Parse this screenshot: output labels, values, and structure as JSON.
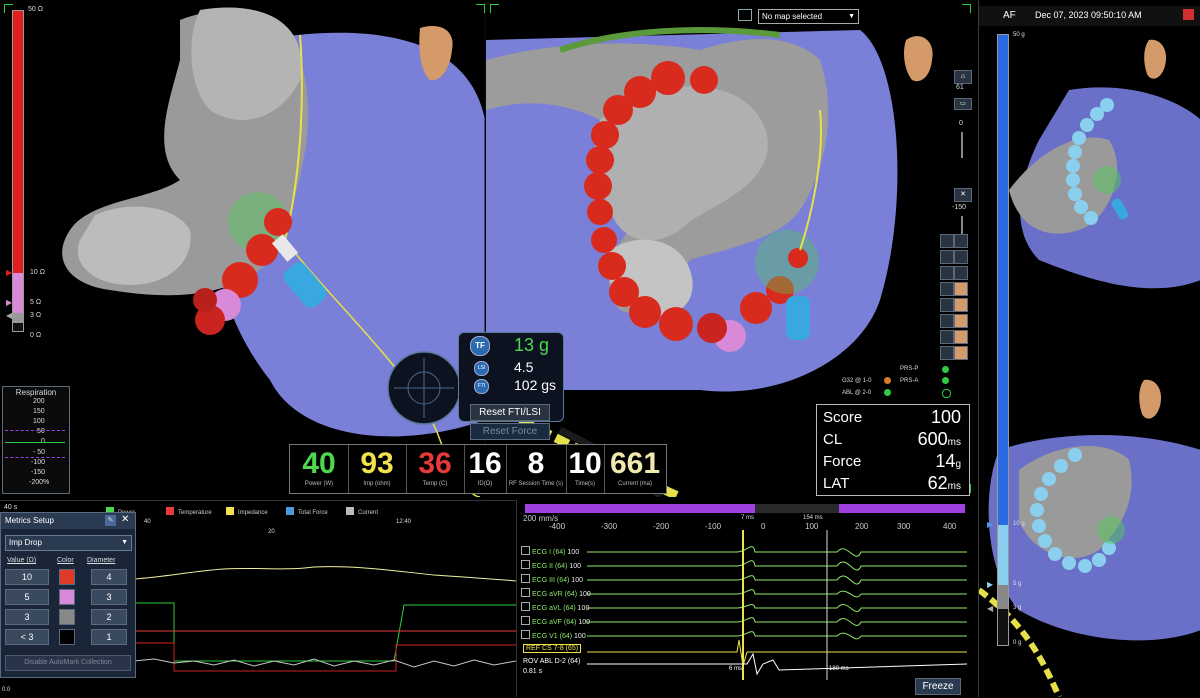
{
  "top_bar": {
    "map_select_value": "No map selected",
    "rhythm": "AF",
    "datetime": "Dec 07, 2023 09:50:10 AM"
  },
  "impedance_scale": {
    "top": "50 Ω",
    "mark_10": "10 Ω",
    "mark_5": "5 Ω",
    "mark_3": "3 Ω",
    "bottom": "0 Ω"
  },
  "force_scale": {
    "top": "50 g",
    "mark_10": "10 g",
    "mark_5": "5 g",
    "mark_3": "3 g",
    "bottom": "0 g"
  },
  "respiration": {
    "title": "Respiration",
    "ticks": [
      "200",
      "150",
      "100",
      "50",
      "0",
      "- 50",
      "-100",
      "-150",
      "-200%"
    ]
  },
  "contact_widget": {
    "tf_label": "TF",
    "tf_value": "13 g",
    "lsi_label": "LSI",
    "lsi_value": "4.5",
    "fti_label": "FTI",
    "fti_value": "102 gs",
    "reset_fti_label": "Reset FTI/LSI",
    "reset_force_label": "Reset Force"
  },
  "metrics": [
    {
      "value": "40",
      "label": "Power (W)",
      "color": "#4cd84c"
    },
    {
      "value": "93",
      "label": "Imp (ohm)",
      "color": "#f0e24a"
    },
    {
      "value": "36",
      "label": "Temp (C)",
      "color": "#e83a3a"
    },
    {
      "value": "16",
      "label": "ID(Ω)",
      "color": "#ffffff"
    },
    {
      "value": "8",
      "label": "RF Session Time (s)",
      "color": "#ffffff"
    },
    {
      "value": "10",
      "label": "Time(s)",
      "color": "#ffffff"
    },
    {
      "value": "661",
      "label": "Current (ma)",
      "color": "#f2e9b0"
    }
  ],
  "score_panel": {
    "rows": [
      {
        "label": "Score",
        "value": "100",
        "unit": ""
      },
      {
        "label": "CL",
        "value": "600",
        "unit": "ms"
      },
      {
        "label": "Force",
        "value": "14",
        "unit": "g"
      },
      {
        "label": "LAT",
        "value": "62",
        "unit": "ms"
      }
    ]
  },
  "catheter_status": {
    "prs_p": "PRS-P",
    "g32": "G32 @ 1-0",
    "prs_a": "PRS-A",
    "abl": "ABL @ 2-0"
  },
  "toolbar_right": {
    "count": "61",
    "value_0": "0",
    "value_neg150": "-150"
  },
  "trend_panel": {
    "duration": "40 s",
    "legend": [
      {
        "label": "Power",
        "color": "#4cd84c"
      },
      {
        "label": "Temperature",
        "color": "#e83a3a"
      },
      {
        "label": "Impedance",
        "color": "#f0e24a"
      },
      {
        "label": "Total Force",
        "color": "#4a9ae0"
      },
      {
        "label": "Current",
        "color": "#bbbbbb"
      }
    ],
    "time_marks": [
      "40",
      "20",
      "12:40"
    ],
    "bottom_value": "0.0"
  },
  "metrics_setup": {
    "title": "Metrics Setup",
    "dropdown_value": "Imp Drop",
    "headers": [
      "Value (Ω)",
      "Color",
      "Diameter"
    ],
    "rows": [
      {
        "value": "10",
        "color": "#e03a2a",
        "diameter": "4"
      },
      {
        "value": "5",
        "color": "#d88ad8",
        "diameter": "3"
      },
      {
        "value": "3",
        "color": "#888888",
        "diameter": "2"
      },
      {
        "value": "< 3",
        "color": "#000000",
        "diameter": "1"
      }
    ],
    "disable_button": "Disable AutoMark Collection"
  },
  "ecg_panel": {
    "speed": "200 mm/s",
    "ticks": [
      "-400",
      "-300",
      "-200",
      "-100",
      "0",
      "100",
      "200",
      "300",
      "400"
    ],
    "markers": [
      "7 ms",
      "154 ms"
    ],
    "channels": [
      {
        "name": "ECG I (64)",
        "gain": "100"
      },
      {
        "name": "ECG II (64)",
        "gain": "100"
      },
      {
        "name": "ECG III (64)",
        "gain": "100"
      },
      {
        "name": "ECG aVR (64)",
        "gain": "100"
      },
      {
        "name": "ECG aVL (64)",
        "gain": "100"
      },
      {
        "name": "ECG aVF (64)",
        "gain": "100"
      },
      {
        "name": "ECG V1 (64)",
        "gain": "100"
      }
    ],
    "ref": "REF CS  7-8 (65)",
    "rov": "ROV ABL     D-2 (64)",
    "rov_time": "0.81 s",
    "lat_a": "6 ms",
    "lat_b": "180 ms",
    "freeze_label": "Freeze"
  }
}
